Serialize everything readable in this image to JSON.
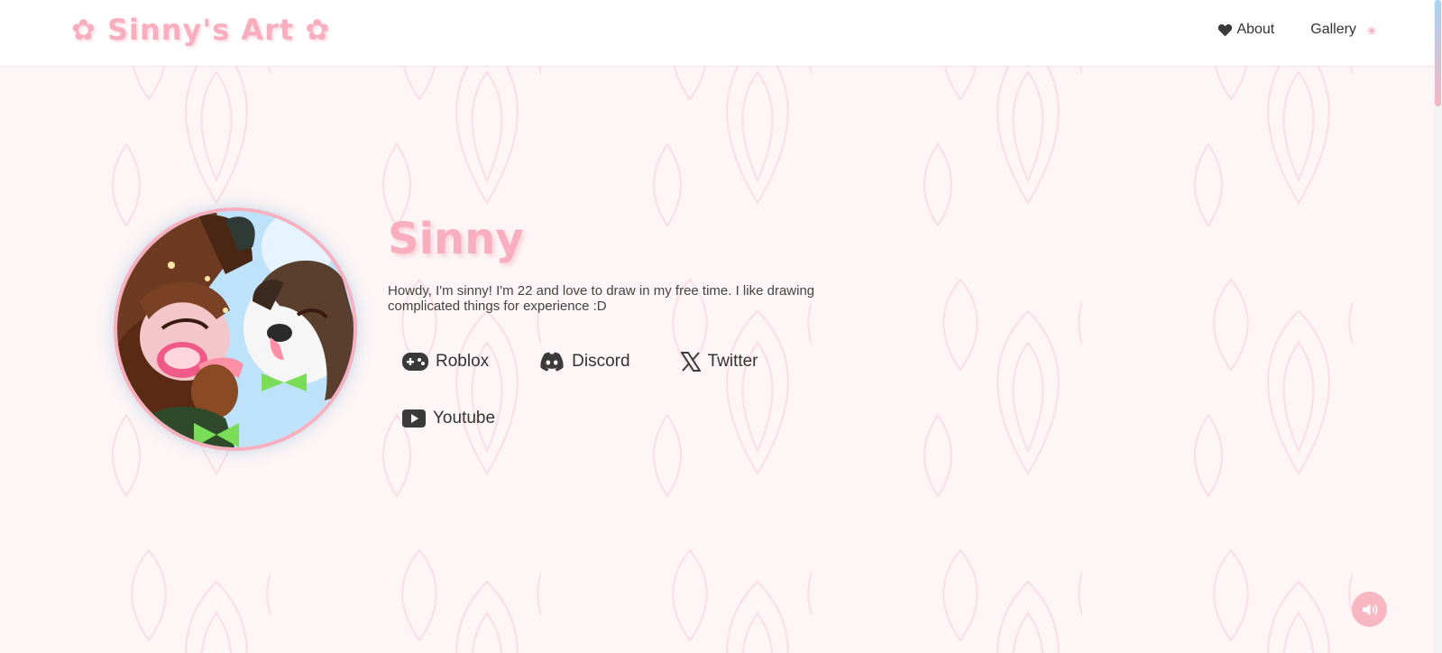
{
  "brand": {
    "title": "Sinny's Art",
    "flower": "✿"
  },
  "nav": {
    "about": "About",
    "gallery": "Gallery",
    "flower": "❀"
  },
  "profile": {
    "name": "Sinny",
    "bio": "Howdy, I'm sinny! I'm 22 and love to draw in my free time. I like drawing complicated things for experience :D",
    "avatar_icon": "profile-art-avatar"
  },
  "links": [
    {
      "label": "Roblox",
      "icon": "gamepad-icon"
    },
    {
      "label": "Discord",
      "icon": "discord-icon"
    },
    {
      "label": "Twitter",
      "icon": "x-twitter-icon"
    },
    {
      "label": "Youtube",
      "icon": "youtube-icon"
    }
  ],
  "controls": {
    "sound_icon": "volume-icon"
  },
  "colors": {
    "accent_pink": "#f8aebf",
    "background": "#fdf5f6",
    "text": "#333333",
    "topbar": "#ffffff"
  }
}
